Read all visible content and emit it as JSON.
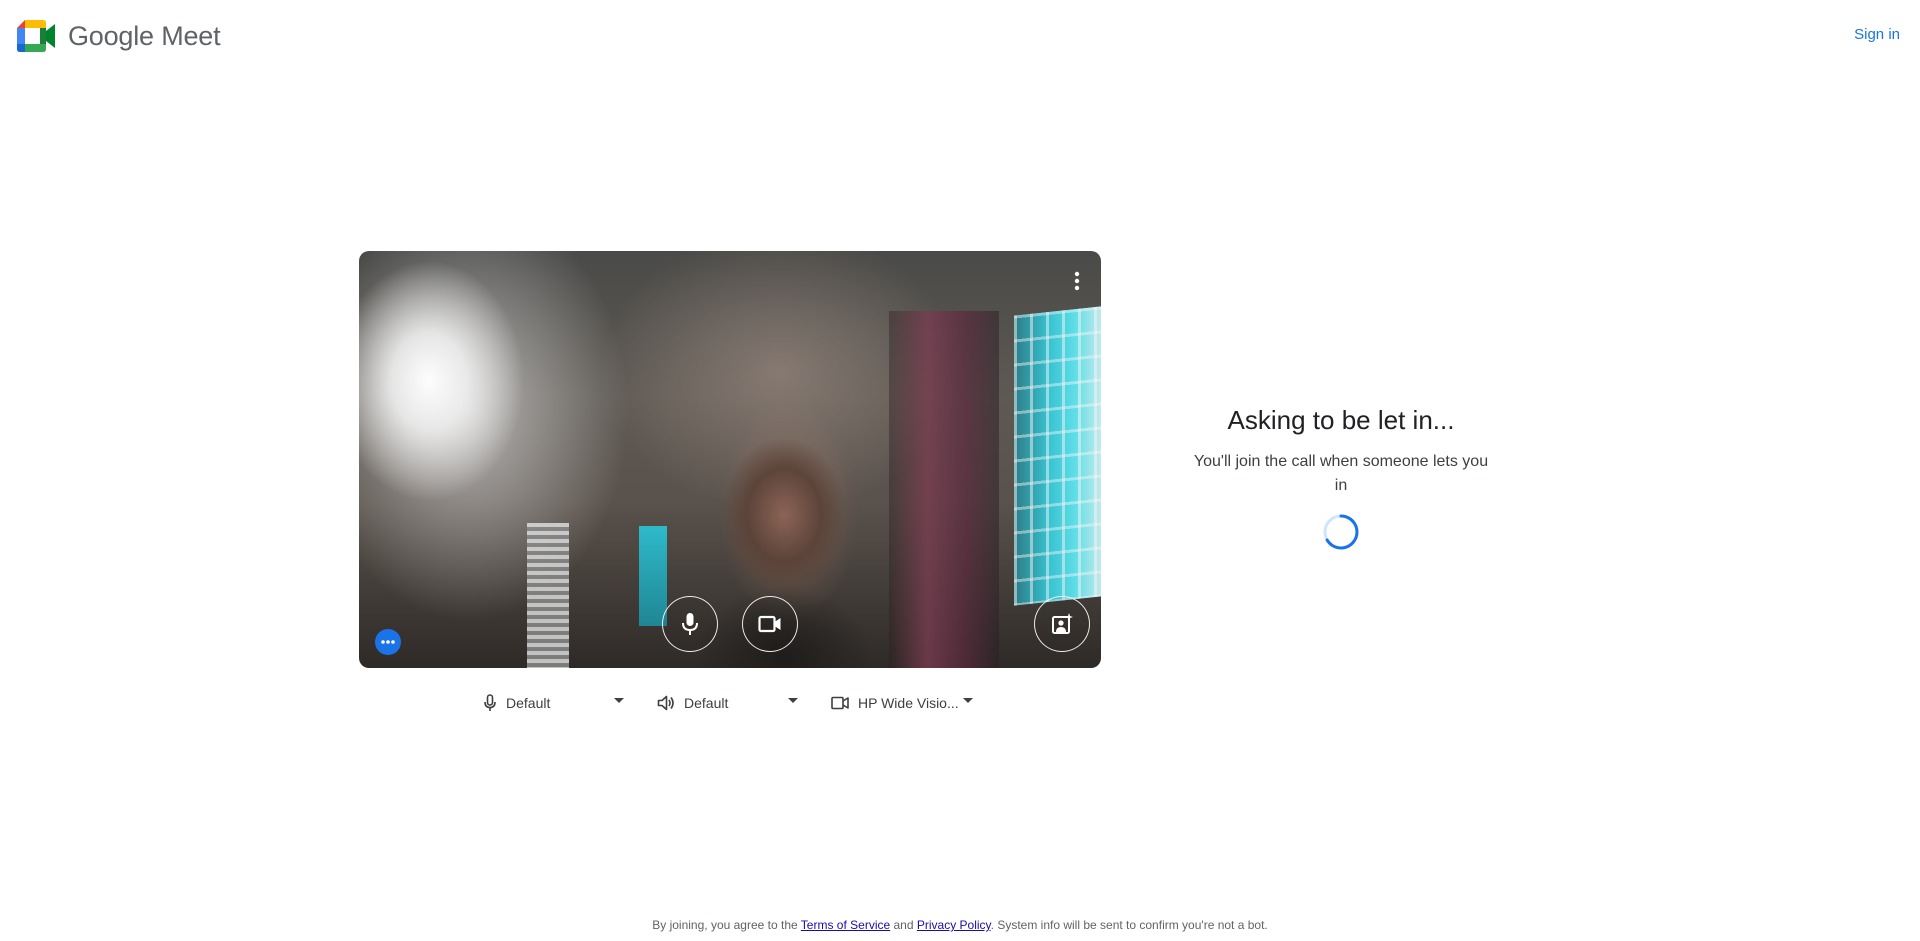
{
  "header": {
    "logo_google": "Google",
    "logo_product": "Meet",
    "sign_in_label": "Sign in"
  },
  "preview": {
    "more_options_icon": "more-vert-icon",
    "mic_icon": "microphone-icon",
    "camera_icon": "videocam-icon",
    "effects_icon": "visual-effects-icon",
    "options_icon": "more-horiz-icon"
  },
  "devices": {
    "microphone": {
      "label": "Default",
      "icon": "microphone-outline-icon"
    },
    "speaker": {
      "label": "Default",
      "icon": "speaker-icon"
    },
    "camera": {
      "label": "HP Wide Visio...",
      "icon": "videocam-outline-icon"
    }
  },
  "status": {
    "title": "Asking to be let in...",
    "subtitle": "You'll join the call when someone lets you in"
  },
  "footer": {
    "prefix": "By joining, you agree to the ",
    "terms_link": "Terms of Service",
    "and": " and ",
    "privacy_link": "Privacy Policy",
    "suffix": ". System info will be sent to confirm you're not a bot."
  },
  "colors": {
    "accent": "#1a73e8",
    "link": "#1a0dab",
    "text_primary": "#202124",
    "text_secondary": "#5f6368"
  }
}
